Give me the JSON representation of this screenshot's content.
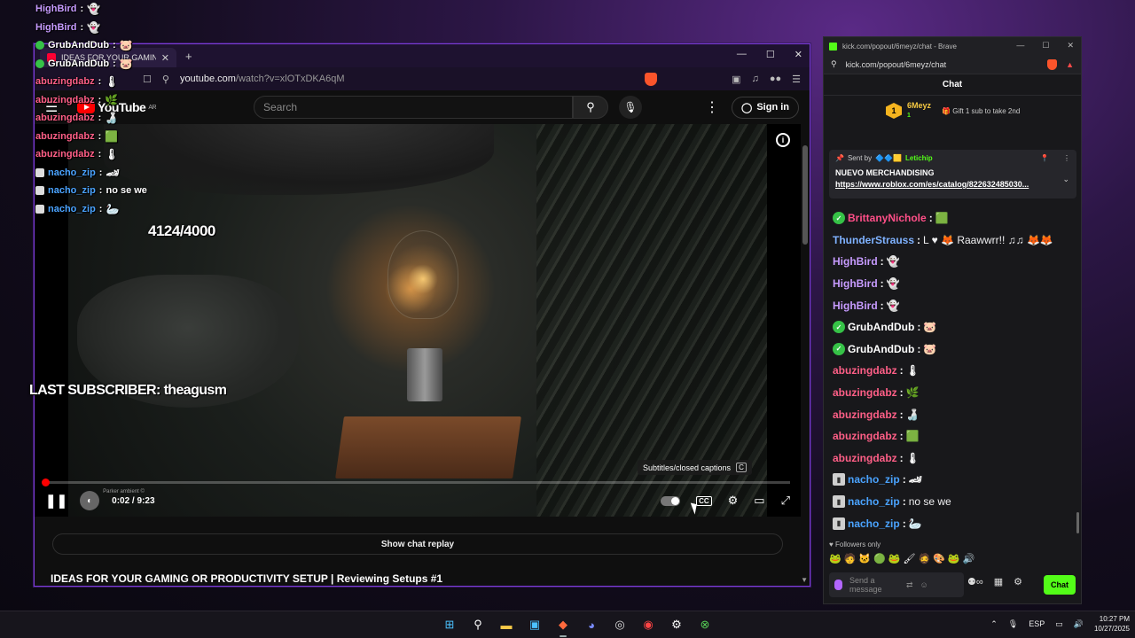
{
  "youtube": {
    "tab_title": "IDEAS FOR YOUR GAMING O",
    "url_host": "youtube.com",
    "url_path": "/watch?v=xlOTxDKA6qM",
    "logo_text": "YouTube",
    "logo_region": "AR",
    "search_placeholder": "Search",
    "sign_in": "Sign in",
    "overlay_count": "4124/4000",
    "overlay_last_subscriber": "LAST SUBSCRIBER: theagusm",
    "time_current": "0:02",
    "time_total": "9:23",
    "time_display": "0:02 / 9:23",
    "tiny_label": "Parker ambient ©",
    "progress": 0.004,
    "cc_tooltip": "Subtitles/closed captions",
    "cc_key": "C",
    "show_chat_replay": "Show chat replay",
    "video_title": "IDEAS FOR YOUR GAMING OR PRODUCTIVITY SETUP | Reviewing Setups #1"
  },
  "stream_chat": [
    {
      "user": "HighBird",
      "color": "#c79bff",
      "emote": "👻",
      "badge": "none"
    },
    {
      "user": "HighBird",
      "color": "#c79bff",
      "emote": "👻",
      "badge": "none"
    },
    {
      "user": "GrubAndDub",
      "color": "#ffffff",
      "emote": "🐷",
      "badge": "green"
    },
    {
      "user": "GrubAndDub",
      "color": "#ffffff",
      "emote": "🐷",
      "badge": "green"
    },
    {
      "user": "abuzingdabz",
      "color": "#ff5f87",
      "emote": "🌡",
      "badge": "none"
    },
    {
      "user": "abuzingdabz",
      "color": "#ff5f87",
      "emote": "🌿",
      "badge": "none"
    },
    {
      "user": "abuzingdabz",
      "color": "#ff5f87",
      "emote": "🍶",
      "badge": "none"
    },
    {
      "user": "abuzingdabz",
      "color": "#ff5f87",
      "emote": "🟩",
      "badge": "none"
    },
    {
      "user": "abuzingdabz",
      "color": "#ff5f87",
      "emote": "🌡",
      "badge": "none"
    },
    {
      "user": "nacho_zip",
      "color": "#4aa3ff",
      "emote": "🏎",
      "badge": "square"
    },
    {
      "user": "nacho_zip",
      "color": "#4aa3ff",
      "text": "no se we",
      "badge": "square"
    },
    {
      "user": "nacho_zip",
      "color": "#4aa3ff",
      "emote": "🦢",
      "badge": "square"
    }
  ],
  "kick": {
    "window_title": "kick.com/popout/6meyz/chat - Brave",
    "url": "kick.com/popout/6meyz/chat",
    "header": "Chat",
    "gift_rank": "1",
    "gift_user": "6Meyz",
    "gift_count": "1",
    "gift_message": "Gift 1 sub to take 2nd",
    "pinned_sent_by": "Sent by",
    "pinned_user": "Letichip",
    "pinned_title": "NUEVO MERCHANDISING",
    "pinned_link": "https://www.roblox.com/es/catalog/822632485030...",
    "messages": [
      {
        "user": "BrittanyNichole",
        "color": "#ff4f88",
        "badge": "green",
        "emote": "🟩"
      },
      {
        "user": "ThunderStrauss",
        "color": "#7fb2ff",
        "badge": "none",
        "text": "L ♥ 🦊 Raawwrr!! ♫♫ 🦊🦊"
      },
      {
        "user": "HighBird",
        "color": "#c79bff",
        "badge": "none",
        "emote": "👻"
      },
      {
        "user": "HighBird",
        "color": "#c79bff",
        "badge": "none",
        "emote": "👻"
      },
      {
        "user": "HighBird",
        "color": "#c79bff",
        "badge": "none",
        "emote": "👻"
      },
      {
        "user": "GrubAndDub",
        "color": "#ffffff",
        "badge": "green",
        "emote": "🐷"
      },
      {
        "user": "GrubAndDub",
        "color": "#ffffff",
        "badge": "green",
        "emote": "🐷"
      },
      {
        "user": "abuzingdabz",
        "color": "#ff5f87",
        "badge": "none",
        "emote": "🌡"
      },
      {
        "user": "abuzingdabz",
        "color": "#ff5f87",
        "badge": "none",
        "emote": "🌿"
      },
      {
        "user": "abuzingdabz",
        "color": "#ff5f87",
        "badge": "none",
        "emote": "🍶"
      },
      {
        "user": "abuzingdabz",
        "color": "#ff5f87",
        "badge": "none",
        "emote": "🟩"
      },
      {
        "user": "abuzingdabz",
        "color": "#ff5f87",
        "badge": "none",
        "emote": "🌡"
      },
      {
        "user": "nacho_zip",
        "color": "#4aa3ff",
        "badge": "square",
        "emote": "🏎"
      },
      {
        "user": "nacho_zip",
        "color": "#4aa3ff",
        "badge": "square",
        "text": "no se we"
      },
      {
        "user": "nacho_zip",
        "color": "#4aa3ff",
        "badge": "square",
        "emote": "🦢"
      }
    ],
    "followers_only": "Followers only",
    "input_placeholder": "Send a message",
    "chat_button": "Chat"
  },
  "taskbar": {
    "language": "ESP",
    "time": "10:27 PM",
    "date": "10/27/2025"
  },
  "colors": {
    "kick_green": "#53fc18",
    "yt_red": "#ff0000",
    "window_border": "#7b3dd6"
  }
}
